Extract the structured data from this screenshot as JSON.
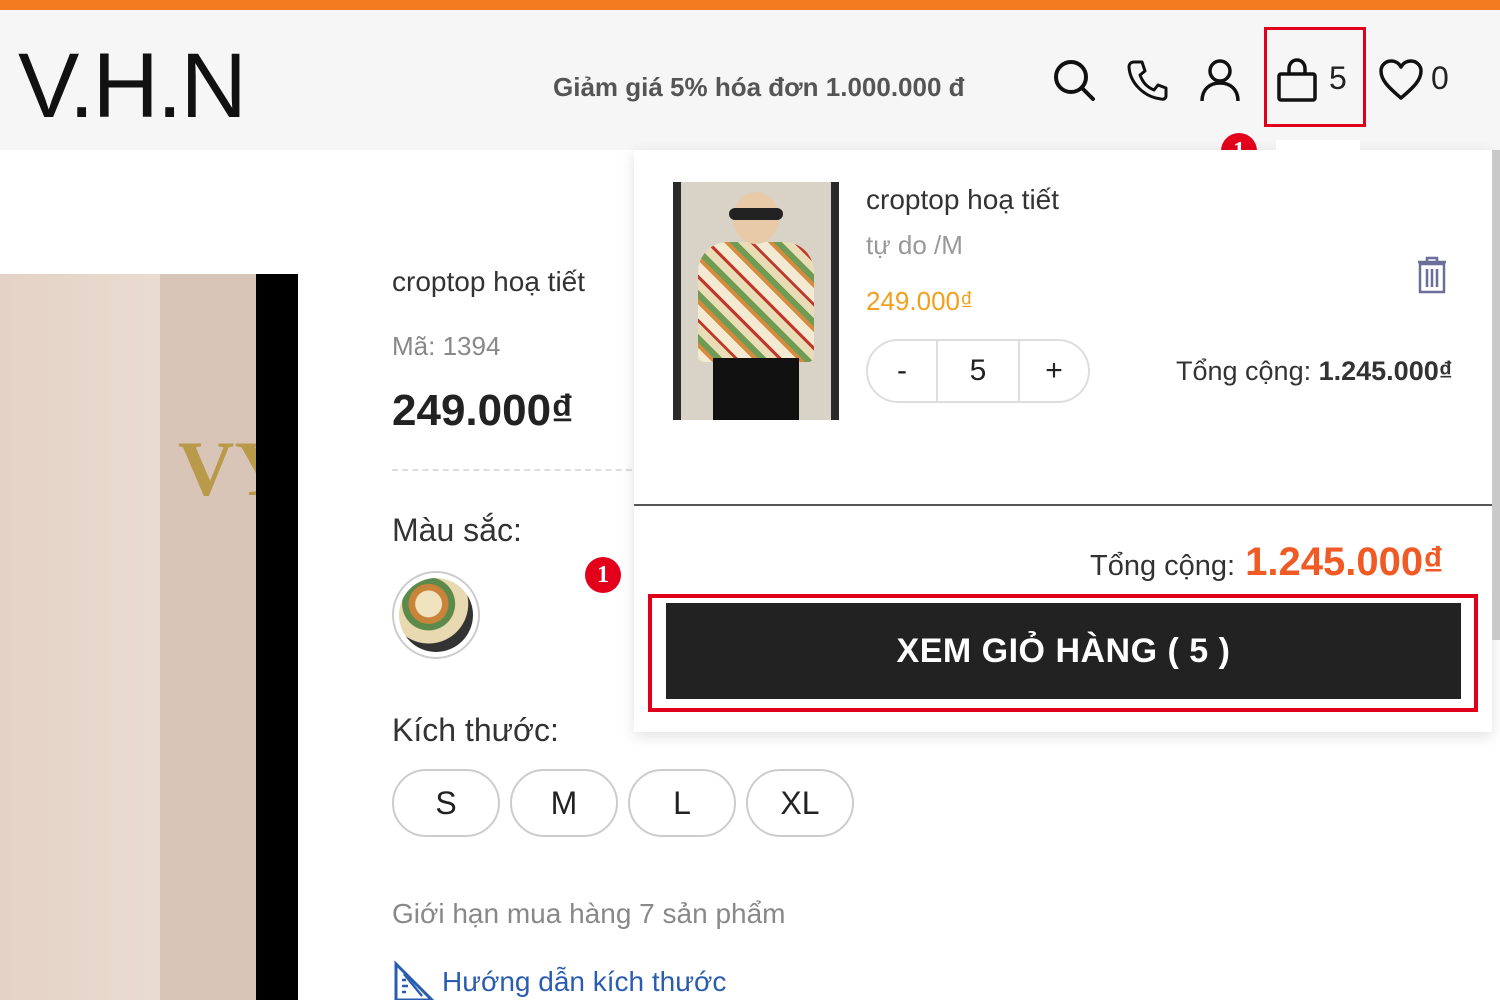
{
  "header": {
    "logo": "V.H.N",
    "promo": "Giảm giá 5% hóa đơn 1.000.000 đ",
    "cart_count": "5",
    "wishlist_count": "0",
    "icons": [
      "search-icon",
      "phone-icon",
      "user-icon",
      "cart-icon",
      "heart-icon"
    ]
  },
  "annotations": {
    "step_1": "1",
    "step_2": "1"
  },
  "product": {
    "title": "croptop hoạ tiết",
    "code": "Mã: 1394",
    "price": "249.000₫",
    "color_label": "Màu sắc:",
    "size_label": "Kích thước:",
    "sizes": [
      "S",
      "M",
      "L",
      "XL"
    ],
    "limit": "Giới hạn mua hàng 7 sản phẩm",
    "size_guide": "Hướng dẫn kích thước"
  },
  "cart_dropdown": {
    "item": {
      "name": "croptop hoạ tiết",
      "variant": "tự do /M",
      "price": "249.000₫",
      "qty_minus": "-",
      "quantity": "5",
      "qty_plus": "+",
      "line_total_label": "Tổng cộng:",
      "line_total": "1.245.000₫"
    },
    "grand_total_label": "Tổng cộng:",
    "grand_total": "1.245.000₫",
    "view_cart_button": "XEM GIỎ HÀNG ( 5 )"
  },
  "colors": {
    "brand_orange": "#f47b20",
    "highlight_red": "#e0001b",
    "price_orange": "#f2a01c",
    "total_red": "#f05a24",
    "button_dark": "#222222"
  }
}
